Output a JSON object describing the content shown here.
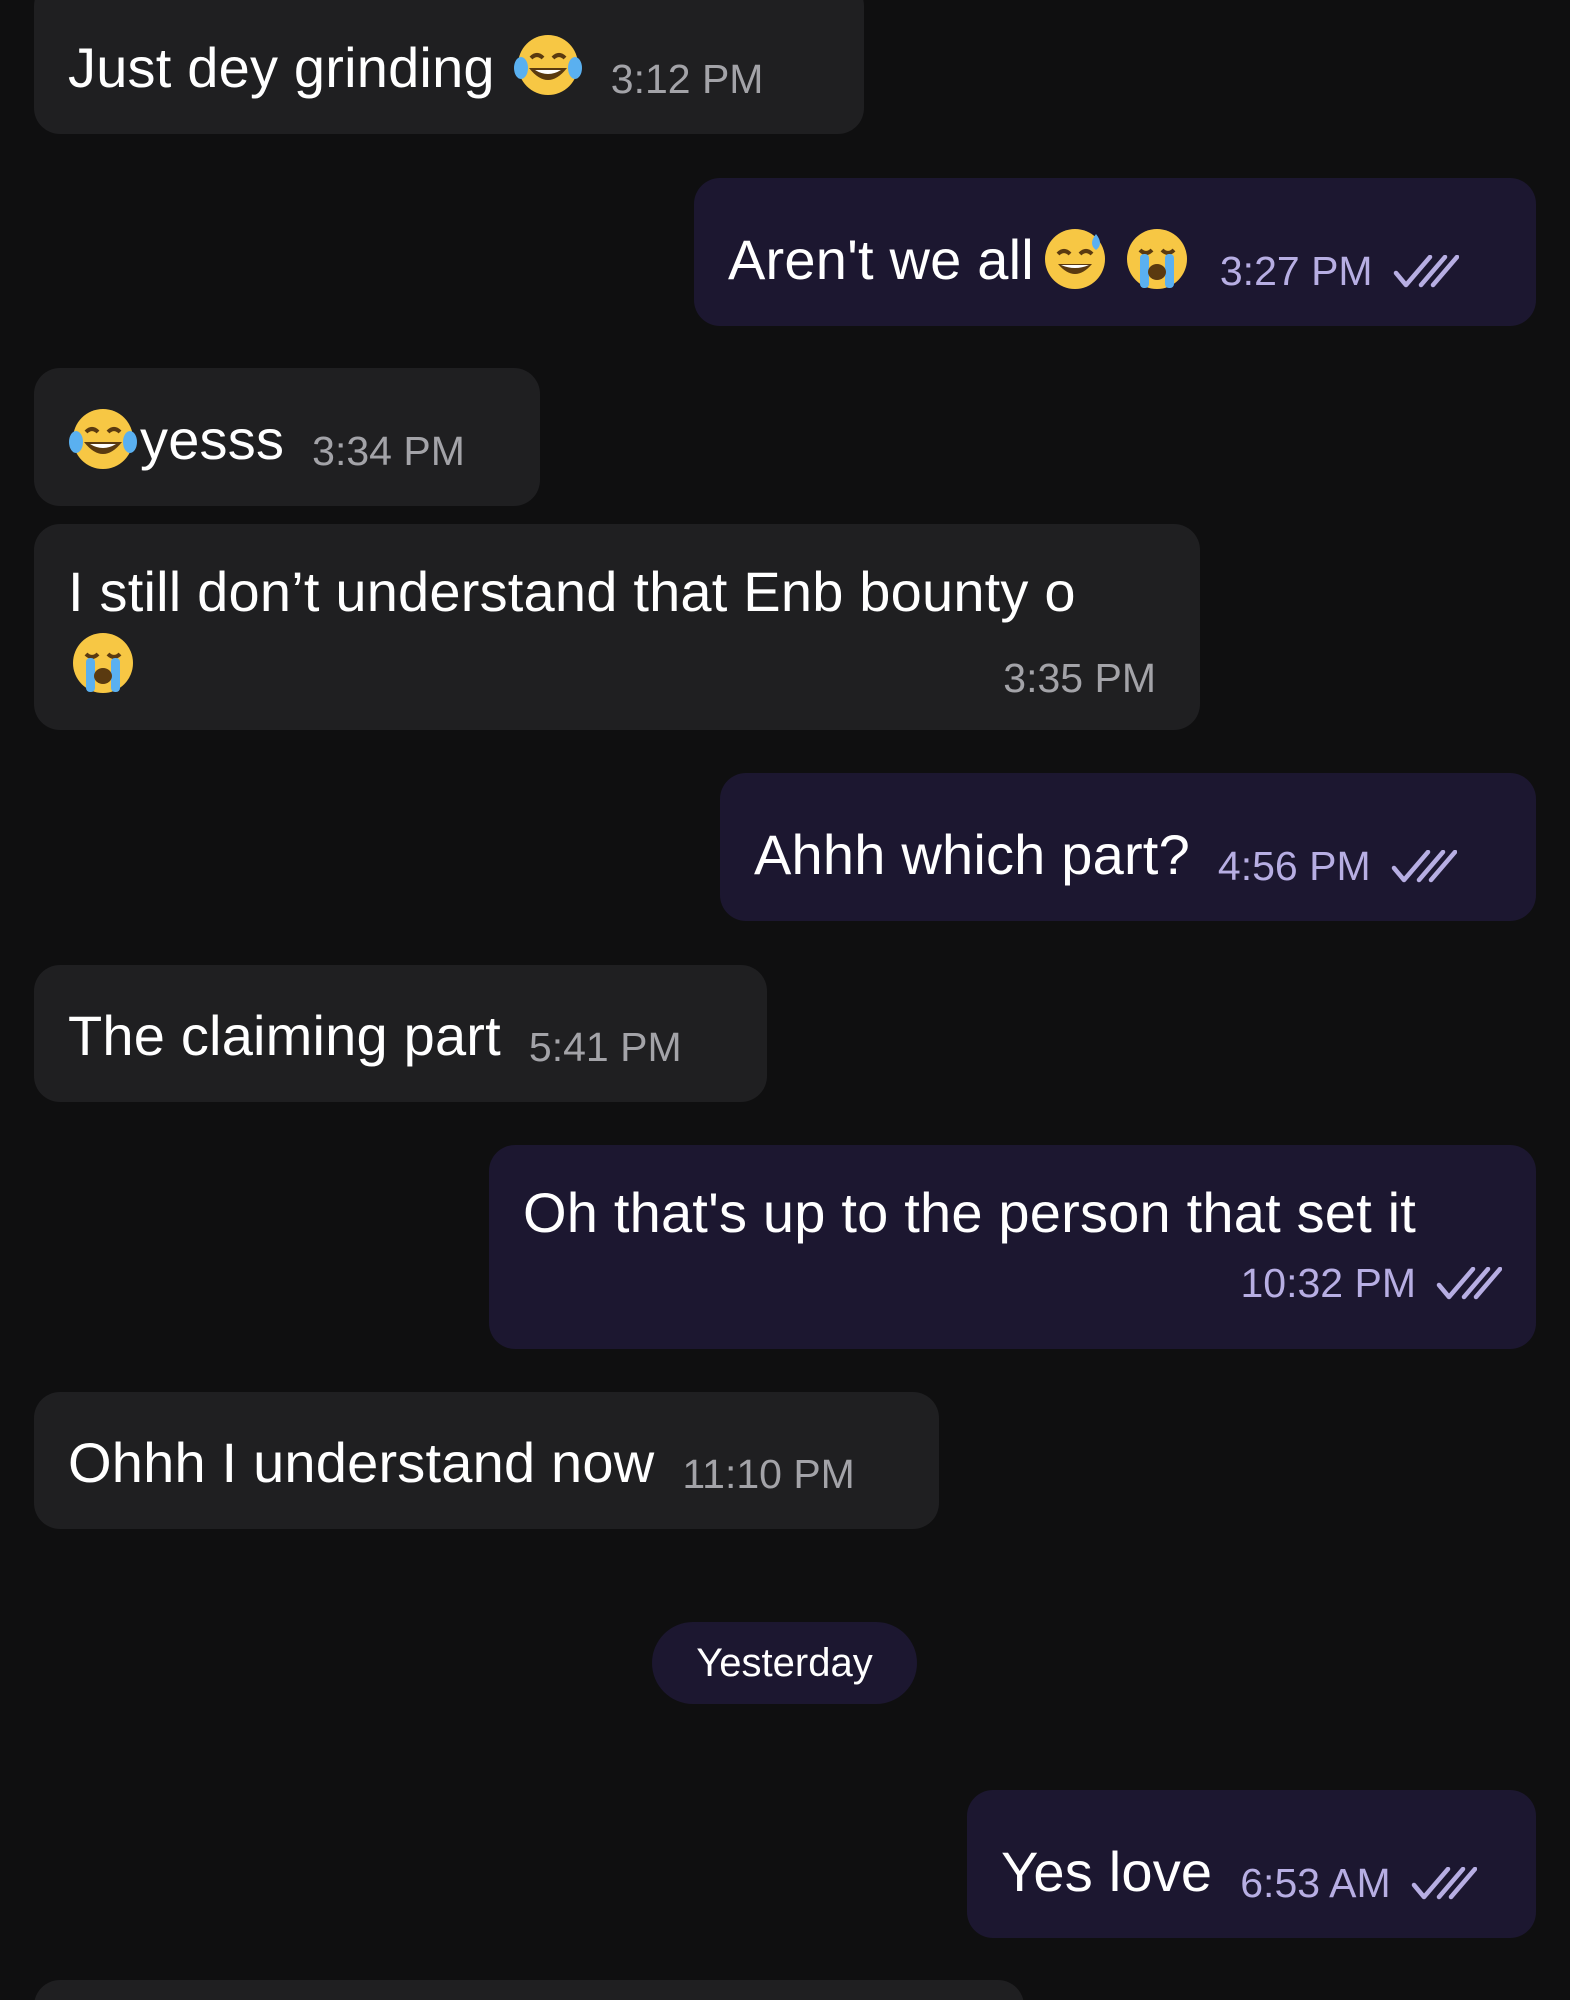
{
  "messages": [
    {
      "direction": "incoming",
      "text": "Just dey grinding",
      "emoji_after": "face-with-tears-of-joy",
      "time": "3:12 PM"
    },
    {
      "direction": "outgoing",
      "text": "Aren't we all",
      "emoji_after": [
        "grinning-face-with-sweat",
        "loudly-crying-face"
      ],
      "time": "3:27 PM",
      "status": "read"
    },
    {
      "direction": "incoming",
      "emoji_before": "face-with-tears-of-joy",
      "text": "yesss",
      "time": "3:34 PM"
    },
    {
      "direction": "incoming",
      "text": "I still don’t understand that Enb bounty o",
      "emoji_line2": "loudly-crying-face",
      "time": "3:35 PM"
    },
    {
      "direction": "outgoing",
      "text": "Ahhh which part?",
      "time": "4:56 PM",
      "status": "read"
    },
    {
      "direction": "incoming",
      "text": "The claiming part",
      "time": "5:41 PM"
    },
    {
      "direction": "outgoing",
      "text": "Oh that's up to the person that set it",
      "time": "10:32 PM",
      "status": "read"
    },
    {
      "direction": "incoming",
      "text": "Ohhh I understand now",
      "time": "11:10 PM"
    },
    {
      "direction": "outgoing",
      "text": "Yes love",
      "time": "6:53 AM",
      "status": "read"
    }
  ],
  "date_separator": "Yesterday",
  "colors": {
    "background": "#0f0f10",
    "incoming_bubble": "#1f1f21",
    "outgoing_bubble": "#1c1730",
    "incoming_time": "#a3a3a8",
    "outgoing_time": "#b7aee3"
  }
}
